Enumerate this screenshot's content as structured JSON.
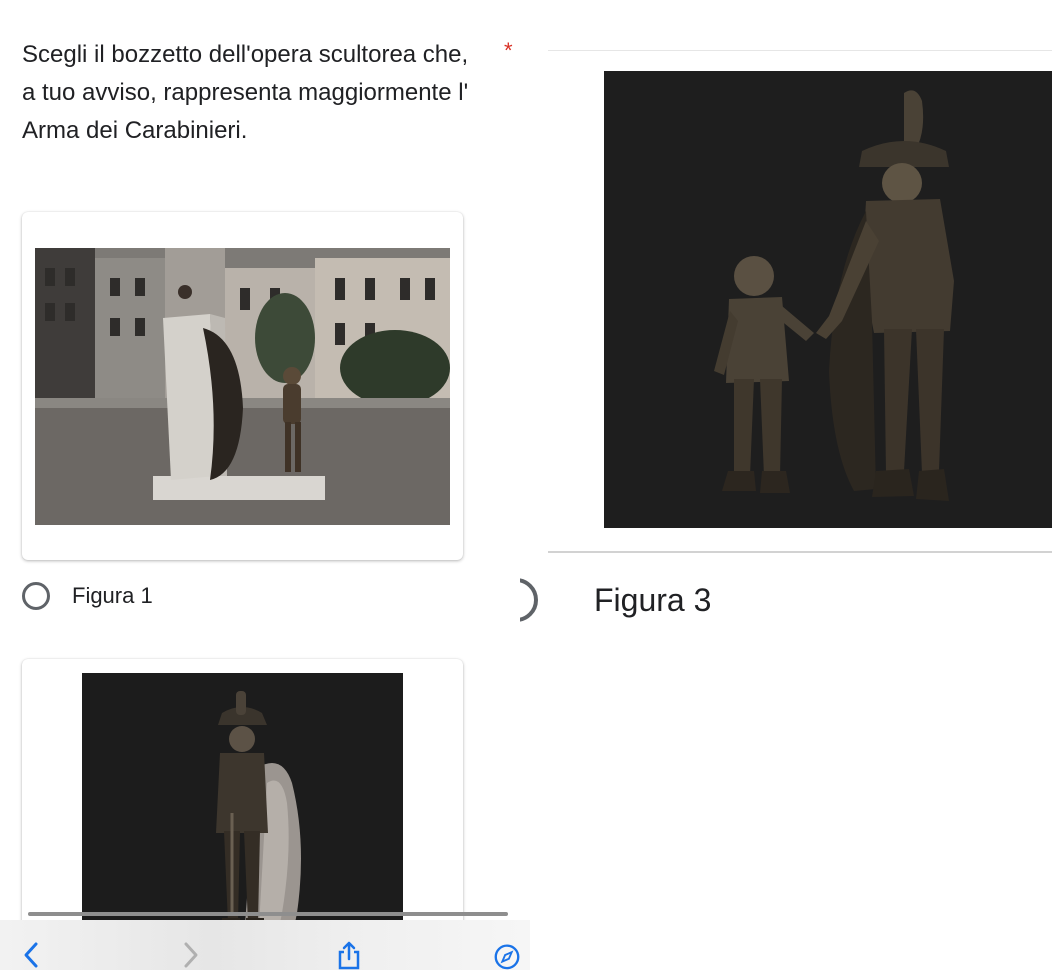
{
  "question": {
    "text": "Scegli il bozzetto dell'opera scultorea che, a tuo avviso, rappresenta maggiormente l' Arma dei Carabinieri.",
    "required_mark": "*"
  },
  "options": [
    {
      "label": "Figura 1",
      "image_icon": "sculpture-photo-icon"
    },
    {
      "label": "",
      "image_icon": "sculpture-render-icon"
    },
    {
      "label": "Figura 3",
      "image_icon": "sculpture-render-icon"
    }
  ],
  "toolbar": {
    "back_icon": "chevron-left-icon",
    "forward_icon": "chevron-right-icon",
    "share_icon": "share-icon",
    "safari_icon": "compass-icon"
  },
  "colors": {
    "required": "#d93025",
    "accent": "#1a73e8",
    "radio": "#5f6368"
  }
}
